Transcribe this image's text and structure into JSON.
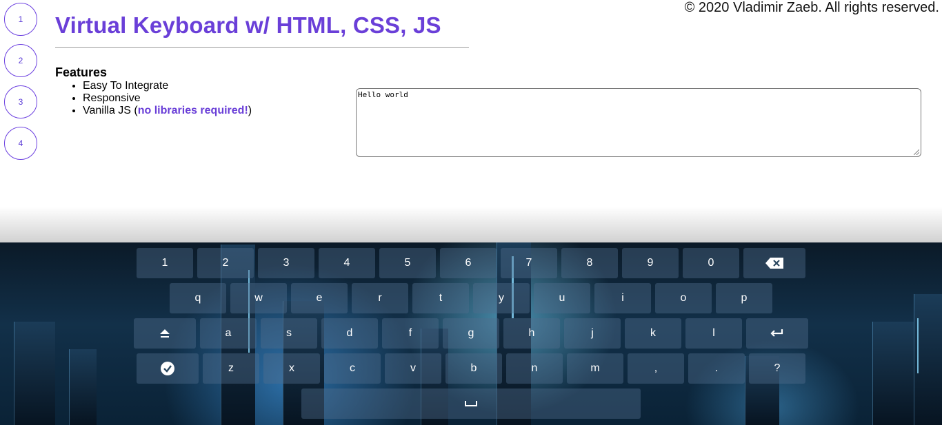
{
  "nav": {
    "circles": [
      "1",
      "2",
      "3",
      "4"
    ]
  },
  "copyright": "© 2020 Vladimir Zaeb. All rights reserved.",
  "title": "Virtual Keyboard w/ HTML, CSS, JS",
  "features": {
    "heading": "Features",
    "items": [
      "Easy To Integrate",
      "Responsive"
    ],
    "vanilla_prefix": "Vanilla JS (",
    "vanilla_accent": "no libraries required!",
    "vanilla_suffix": ")"
  },
  "textarea": {
    "value": "Hello world"
  },
  "keyboard": {
    "row1": [
      "1",
      "2",
      "3",
      "4",
      "5",
      "6",
      "7",
      "8",
      "9",
      "0"
    ],
    "row2": [
      "q",
      "w",
      "e",
      "r",
      "t",
      "y",
      "u",
      "i",
      "o",
      "p"
    ],
    "row3": [
      "a",
      "s",
      "d",
      "f",
      "g",
      "h",
      "j",
      "k",
      "l"
    ],
    "row4": [
      "z",
      "x",
      "c",
      "v",
      "b",
      "n",
      "m",
      ",",
      "."
    ],
    "icons": {
      "backspace": "backspace-icon",
      "shift": "shift-icon",
      "enter": "enter-icon",
      "done": "check-circle-icon",
      "space": "space-icon",
      "question": "?"
    }
  },
  "colors": {
    "accent": "#6a3fd8",
    "key_bg": "rgba(80,110,140,0.42)"
  }
}
